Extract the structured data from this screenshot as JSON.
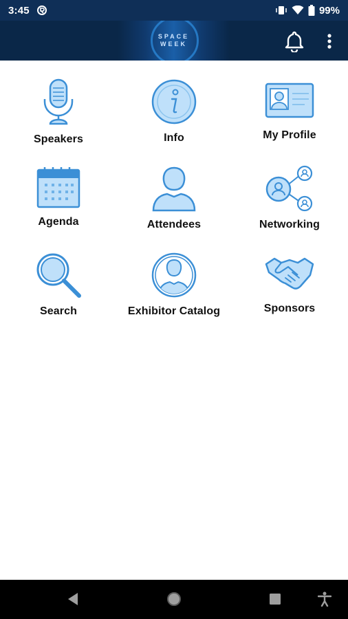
{
  "status_bar": {
    "time": "3:45",
    "battery_text": "99%"
  },
  "app_bar": {
    "logo_text": "SPACE WEEK"
  },
  "tiles": [
    {
      "label": "Speakers",
      "icon": "microphone-icon"
    },
    {
      "label": "Info",
      "icon": "info-icon"
    },
    {
      "label": "My Profile",
      "icon": "id-card-icon"
    },
    {
      "label": "Agenda",
      "icon": "calendar-icon"
    },
    {
      "label": "Attendees",
      "icon": "person-icon"
    },
    {
      "label": "Networking",
      "icon": "network-icon"
    },
    {
      "label": "Search",
      "icon": "magnifier-icon"
    },
    {
      "label": "Exhibitor Catalog",
      "icon": "exhibitor-person-icon"
    },
    {
      "label": "Sponsors",
      "icon": "handshake-icon"
    }
  ],
  "colors": {
    "status_bar_bg": "#0f2f57",
    "app_bar_bg": "#0a2748",
    "icon_blue": "#3b8fd6",
    "icon_fill": "#bfe0fa"
  }
}
